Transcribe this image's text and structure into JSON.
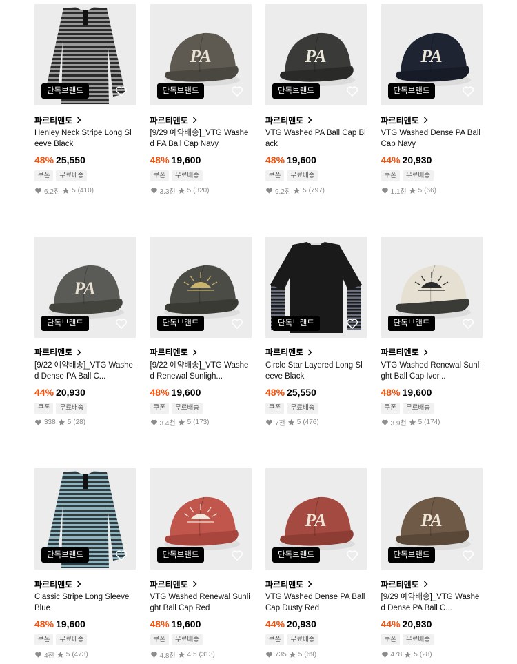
{
  "colors": {
    "accent": "#f2520c",
    "badge_bg": "#000000",
    "tag_bg": "#f1f1f1"
  },
  "products": [
    {
      "name": "Henley Neck Stripe Long Sleeve Black",
      "discount": "48%",
      "price": "25,550",
      "likes": "6.2천",
      "rating": "5",
      "reviews": "(410)",
      "image": "stripe-shirt-black"
    },
    {
      "name": "[9/29 예약배송]_VTG Washed PA Ball Cap Navy",
      "discount": "48%",
      "price": "19,600",
      "likes": "3.3천",
      "rating": "5",
      "reviews": "(320)",
      "image": "cap-gray"
    },
    {
      "name": "VTG Washed PA Ball Cap Black",
      "discount": "48%",
      "price": "19,600",
      "likes": "9.2천",
      "rating": "5",
      "reviews": "(797)",
      "image": "cap-black"
    },
    {
      "name": "VTG Washed Dense PA Ball Cap Navy",
      "discount": "44%",
      "price": "20,930",
      "likes": "1.1천",
      "rating": "5",
      "reviews": "(66)",
      "image": "cap-navy"
    },
    {
      "name": "[9/22 예약배송]_VTG Washed Dense PA Ball C...",
      "discount": "44%",
      "price": "20,930",
      "likes": "338",
      "rating": "5",
      "reviews": "(28)",
      "image": "cap-charcoal"
    },
    {
      "name": "[9/22 예약배송]_VTG Washed Renewal Sunligh...",
      "discount": "48%",
      "price": "19,600",
      "likes": "3.4천",
      "rating": "5",
      "reviews": "(173)",
      "image": "cap-sunlight-charcoal"
    },
    {
      "name": "Circle Star Layered Long Sleeve Black",
      "discount": "48%",
      "price": "25,550",
      "likes": "7천",
      "rating": "5",
      "reviews": "(476)",
      "image": "layered-shirt-black"
    },
    {
      "name": "VTG Washed Renewal Sunlight Ball Cap Ivor...",
      "discount": "48%",
      "price": "19,600",
      "likes": "3.9천",
      "rating": "5",
      "reviews": "(174)",
      "image": "cap-sunlight-ivory"
    },
    {
      "name": "Classic Stripe Long Sleeve Blue",
      "discount": "48%",
      "price": "19,600",
      "likes": "4천",
      "rating": "5",
      "reviews": "(473)",
      "image": "stripe-shirt-blue"
    },
    {
      "name": "VTG Washed Renewal Sunlight Ball Cap Red",
      "discount": "48%",
      "price": "19,600",
      "likes": "4.8천",
      "rating": "4.5",
      "reviews": "(313)",
      "image": "cap-sunlight-red"
    },
    {
      "name": "VTG Washed Dense PA Ball Cap Dusty Red",
      "discount": "44%",
      "price": "20,930",
      "likes": "735",
      "rating": "5",
      "reviews": "(69)",
      "image": "cap-dusty-red"
    },
    {
      "name": "[9/29 예약배송]_VTG Washed Dense PA Ball C...",
      "discount": "44%",
      "price": "20,930",
      "likes": "478",
      "rating": "5",
      "reviews": "(28)",
      "image": "cap-brown"
    }
  ],
  "common": {
    "brand": "파르티멘토",
    "badge": "단독브랜드",
    "tag_coupon": "쿠폰",
    "tag_shipping": "무료배송"
  }
}
